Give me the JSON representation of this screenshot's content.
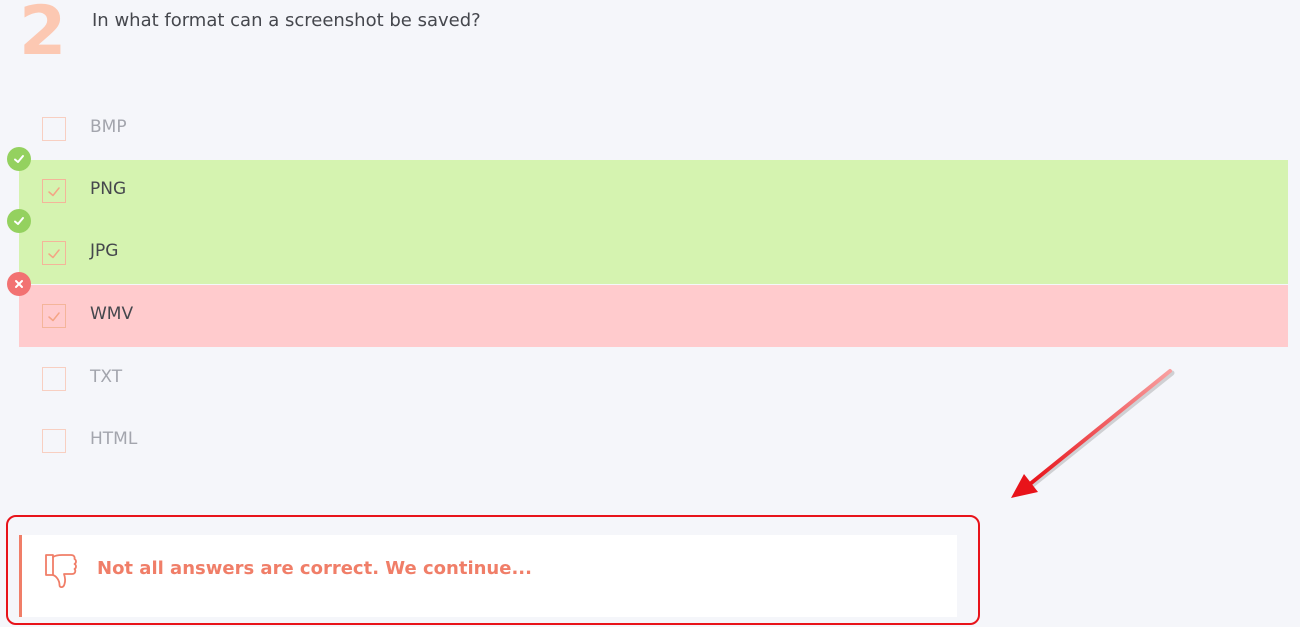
{
  "question": {
    "number": "2",
    "text": "In what format can a screenshot be saved?"
  },
  "options": [
    {
      "label": "BMP",
      "checked": false,
      "status": "none"
    },
    {
      "label": "PNG",
      "checked": true,
      "status": "correct"
    },
    {
      "label": "JPG",
      "checked": true,
      "status": "correct"
    },
    {
      "label": "WMV",
      "checked": true,
      "status": "wrong"
    },
    {
      "label": "TXT",
      "checked": false,
      "status": "none"
    },
    {
      "label": "HTML",
      "checked": false,
      "status": "none"
    }
  ],
  "feedback": {
    "icon": "thumbs-down-icon",
    "text": "Not all answers are correct. We continue..."
  },
  "colors": {
    "accent": "#f07e68",
    "correct_bg": "#d5f3b0",
    "wrong_bg": "#ffcbcd",
    "correct_badge": "#94d15f",
    "wrong_badge": "#f27272",
    "annotation": "#e8131a"
  }
}
